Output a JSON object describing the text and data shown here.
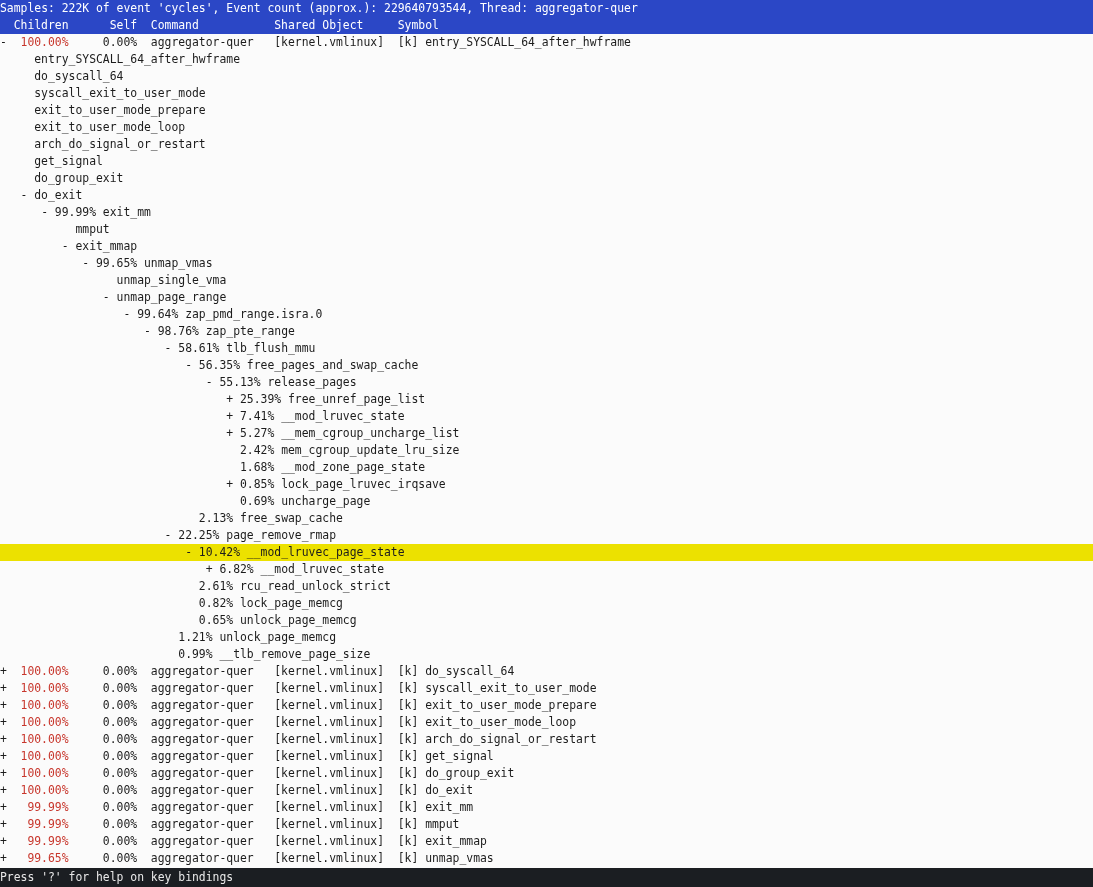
{
  "title": "Samples: 222K of event 'cycles', Event count (approx.): 229640793544, Thread: aggregator-quer",
  "columns": [
    "Children",
    "Self",
    "Command",
    "Shared Object",
    "Symbol"
  ],
  "entries": [
    {
      "sign": "-",
      "children_pct": "100.00%",
      "self_pct": "0.00%",
      "command": "aggregator-quer",
      "shared_object": "[kernel.vmlinux]",
      "symbol_type": "[k]",
      "symbol": "entry_SYSCALL_64_after_hwframe",
      "selected": false,
      "callchain": [
        {
          "symbol": "entry_SYSCALL_64_after_hwframe",
          "selected": false
        },
        {
          "symbol": "do_syscall_64",
          "selected": false
        },
        {
          "symbol": "syscall_exit_to_user_mode",
          "selected": false
        },
        {
          "symbol": "exit_to_user_mode_prepare",
          "selected": false
        },
        {
          "symbol": "exit_to_user_mode_loop",
          "selected": false
        },
        {
          "symbol": "arch_do_signal_or_restart",
          "selected": false
        },
        {
          "symbol": "get_signal",
          "selected": false
        },
        {
          "symbol": "do_group_exit",
          "selected": false
        },
        {
          "sign": "-",
          "symbol": "do_exit",
          "selected": false,
          "children": [
            {
              "sign": "-",
              "percent": "99.99%",
              "symbol": "exit_mm",
              "selected": false,
              "children": [
                {
                  "symbol": "mmput",
                  "selected": false
                },
                {
                  "sign": "-",
                  "symbol": "exit_mmap",
                  "selected": false,
                  "children": [
                    {
                      "sign": "-",
                      "percent": "99.65%",
                      "symbol": "unmap_vmas",
                      "selected": false,
                      "children": [
                        {
                          "symbol": "unmap_single_vma",
                          "selected": false
                        },
                        {
                          "sign": "-",
                          "symbol": "unmap_page_range",
                          "selected": false,
                          "children": [
                            {
                              "sign": "-",
                              "percent": "99.64%",
                              "symbol": "zap_pmd_range.isra.0",
                              "selected": false,
                              "children": [
                                {
                                  "sign": "-",
                                  "percent": "98.76%",
                                  "symbol": "zap_pte_range",
                                  "selected": false,
                                  "children": [
                                    {
                                      "sign": "-",
                                      "percent": "58.61%",
                                      "symbol": "tlb_flush_mmu",
                                      "selected": false,
                                      "children": [
                                        {
                                          "sign": "-",
                                          "percent": "56.35%",
                                          "symbol": "free_pages_and_swap_cache",
                                          "selected": false,
                                          "children": [
                                            {
                                              "sign": "-",
                                              "percent": "55.13%",
                                              "symbol": "release_pages",
                                              "selected": false,
                                              "children": [
                                                {
                                                  "sign": "+",
                                                  "percent": "25.39%",
                                                  "symbol": "free_unref_page_list",
                                                  "selected": false
                                                },
                                                {
                                                  "sign": "+",
                                                  "percent": "7.41%",
                                                  "symbol": "__mod_lruvec_state",
                                                  "selected": false
                                                },
                                                {
                                                  "sign": "+",
                                                  "percent": "5.27%",
                                                  "symbol": "__mem_cgroup_uncharge_list",
                                                  "selected": false
                                                },
                                                {
                                                  "percent": "2.42%",
                                                  "symbol": "mem_cgroup_update_lru_size",
                                                  "selected": false
                                                },
                                                {
                                                  "percent": "1.68%",
                                                  "symbol": "__mod_zone_page_state",
                                                  "selected": false
                                                },
                                                {
                                                  "sign": "+",
                                                  "percent": "0.85%",
                                                  "symbol": "lock_page_lruvec_irqsave",
                                                  "selected": false
                                                },
                                                {
                                                  "percent": "0.69%",
                                                  "symbol": "uncharge_page",
                                                  "selected": false
                                                }
                                              ]
                                            }
                                          ]
                                        },
                                        {
                                          "percent": "2.13%",
                                          "symbol": "free_swap_cache",
                                          "selected": false
                                        }
                                      ]
                                    },
                                    {
                                      "sign": "-",
                                      "percent": "22.25%",
                                      "symbol": "page_remove_rmap",
                                      "selected": false,
                                      "children": [
                                        {
                                          "sign": "-",
                                          "percent": "10.42%",
                                          "symbol": "__mod_lruvec_page_state",
                                          "selected": true,
                                          "children": [
                                            {
                                              "sign": "+",
                                              "percent": "6.82%",
                                              "symbol": "__mod_lruvec_state",
                                              "selected": false
                                            }
                                          ]
                                        },
                                        {
                                          "percent": "2.61%",
                                          "symbol": "rcu_read_unlock_strict",
                                          "selected": false
                                        },
                                        {
                                          "percent": "0.82%",
                                          "symbol": "lock_page_memcg",
                                          "selected": false
                                        },
                                        {
                                          "percent": "0.65%",
                                          "symbol": "unlock_page_memcg",
                                          "selected": false
                                        }
                                      ]
                                    },
                                    {
                                      "percent": "1.21%",
                                      "symbol": "unlock_page_memcg",
                                      "selected": false
                                    },
                                    {
                                      "percent": "0.99%",
                                      "symbol": "__tlb_remove_page_size",
                                      "selected": false
                                    }
                                  ]
                                }
                              ]
                            }
                          ]
                        }
                      ]
                    }
                  ]
                }
              ]
            }
          ]
        }
      ]
    },
    {
      "sign": "+",
      "children_pct": "100.00%",
      "self_pct": "0.00%",
      "command": "aggregator-quer",
      "shared_object": "[kernel.vmlinux]",
      "symbol_type": "[k]",
      "symbol": "do_syscall_64",
      "selected": false
    },
    {
      "sign": "+",
      "children_pct": "100.00%",
      "self_pct": "0.00%",
      "command": "aggregator-quer",
      "shared_object": "[kernel.vmlinux]",
      "symbol_type": "[k]",
      "symbol": "syscall_exit_to_user_mode",
      "selected": false
    },
    {
      "sign": "+",
      "children_pct": "100.00%",
      "self_pct": "0.00%",
      "command": "aggregator-quer",
      "shared_object": "[kernel.vmlinux]",
      "symbol_type": "[k]",
      "symbol": "exit_to_user_mode_prepare",
      "selected": false
    },
    {
      "sign": "+",
      "children_pct": "100.00%",
      "self_pct": "0.00%",
      "command": "aggregator-quer",
      "shared_object": "[kernel.vmlinux]",
      "symbol_type": "[k]",
      "symbol": "exit_to_user_mode_loop",
      "selected": false
    },
    {
      "sign": "+",
      "children_pct": "100.00%",
      "self_pct": "0.00%",
      "command": "aggregator-quer",
      "shared_object": "[kernel.vmlinux]",
      "symbol_type": "[k]",
      "symbol": "arch_do_signal_or_restart",
      "selected": false
    },
    {
      "sign": "+",
      "children_pct": "100.00%",
      "self_pct": "0.00%",
      "command": "aggregator-quer",
      "shared_object": "[kernel.vmlinux]",
      "symbol_type": "[k]",
      "symbol": "get_signal",
      "selected": false
    },
    {
      "sign": "+",
      "children_pct": "100.00%",
      "self_pct": "0.00%",
      "command": "aggregator-quer",
      "shared_object": "[kernel.vmlinux]",
      "symbol_type": "[k]",
      "symbol": "do_group_exit",
      "selected": false
    },
    {
      "sign": "+",
      "children_pct": "100.00%",
      "self_pct": "0.00%",
      "command": "aggregator-quer",
      "shared_object": "[kernel.vmlinux]",
      "symbol_type": "[k]",
      "symbol": "do_exit",
      "selected": false
    },
    {
      "sign": "+",
      "children_pct": "99.99%",
      "self_pct": "0.00%",
      "command": "aggregator-quer",
      "shared_object": "[kernel.vmlinux]",
      "symbol_type": "[k]",
      "symbol": "exit_mm",
      "selected": false
    },
    {
      "sign": "+",
      "children_pct": "99.99%",
      "self_pct": "0.00%",
      "command": "aggregator-quer",
      "shared_object": "[kernel.vmlinux]",
      "symbol_type": "[k]",
      "symbol": "mmput",
      "selected": false
    },
    {
      "sign": "+",
      "children_pct": "99.99%",
      "self_pct": "0.00%",
      "command": "aggregator-quer",
      "shared_object": "[kernel.vmlinux]",
      "symbol_type": "[k]",
      "symbol": "exit_mmap",
      "selected": false
    },
    {
      "sign": "+",
      "children_pct": "99.65%",
      "self_pct": "0.00%",
      "command": "aggregator-quer",
      "shared_object": "[kernel.vmlinux]",
      "symbol_type": "[k]",
      "symbol": "unmap_vmas",
      "selected": false
    }
  ],
  "status_bar": "Press '?' for help on key bindings"
}
